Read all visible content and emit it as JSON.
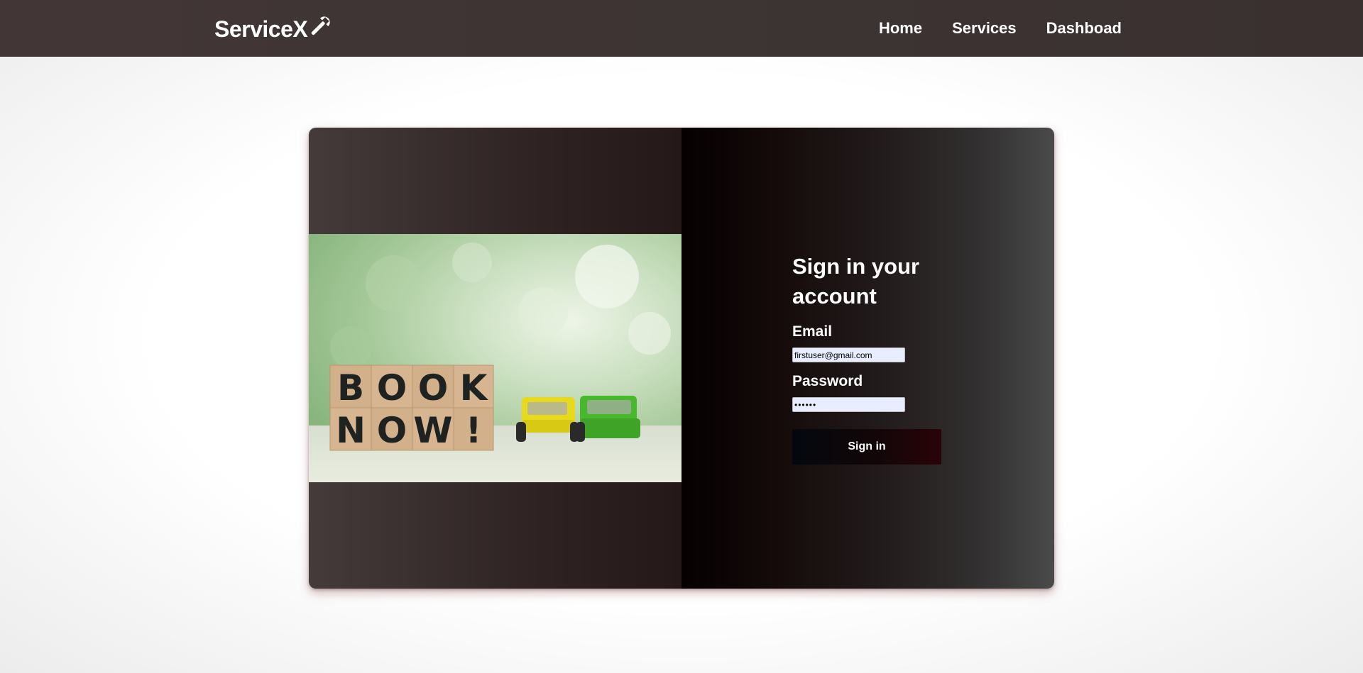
{
  "navbar": {
    "brand": "ServiceX",
    "brand_icon": "wrench-icon",
    "links": [
      {
        "label": "Home"
      },
      {
        "label": "Services"
      },
      {
        "label": "Dashboad"
      }
    ]
  },
  "hero": {
    "row1": [
      "B",
      "O",
      "O",
      "K"
    ],
    "row2": [
      "N",
      "O",
      "W",
      "!"
    ]
  },
  "signin": {
    "title": "Sign in your account",
    "email_label": "Email",
    "email_value": "firstuser@gmail.com",
    "password_label": "Password",
    "password_value": "••••••",
    "button_label": "Sign in"
  }
}
